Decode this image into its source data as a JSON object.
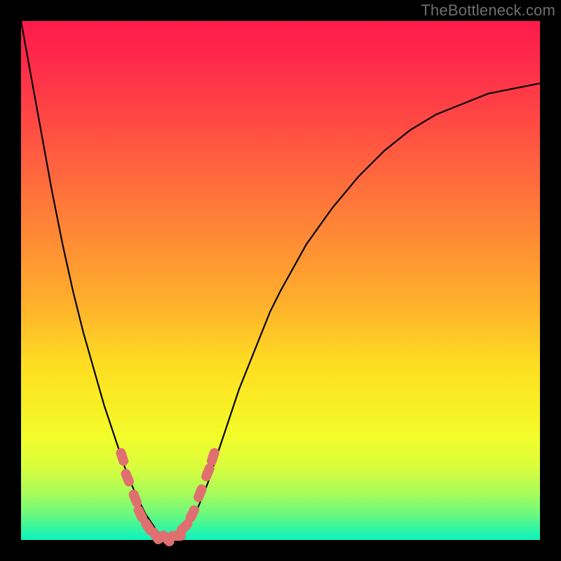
{
  "watermark": "TheBottleneck.com",
  "gradient_colors": {
    "top": "#fe1a4b",
    "mid_upper": "#ff6f3c",
    "mid": "#fedd22",
    "mid_lower": "#d9fd3c",
    "bottom": "#0cf3c0"
  },
  "chart_data": {
    "type": "line",
    "title": "",
    "xlabel": "",
    "ylabel": "",
    "xlim": [
      0,
      100
    ],
    "ylim": [
      0,
      100
    ],
    "x": [
      0,
      2,
      4,
      6,
      8,
      10,
      12,
      14,
      16,
      18,
      20,
      22,
      24,
      26,
      28,
      30,
      32,
      34,
      36,
      38,
      40,
      42,
      44,
      46,
      48,
      50,
      55,
      60,
      65,
      70,
      75,
      80,
      85,
      90,
      95,
      100
    ],
    "values": [
      100,
      89,
      78,
      67,
      57,
      48,
      40,
      33,
      26,
      20,
      14,
      9,
      5,
      2,
      0,
      0,
      2,
      6,
      11,
      17,
      23,
      29,
      34,
      39,
      44,
      48,
      57,
      64,
      70,
      75,
      79,
      82,
      84,
      86,
      87,
      88
    ],
    "curve_min_x": 28,
    "note": "V-shaped bottleneck curve; y=0 is optimal (green), y=100 is worst (red).",
    "markers": {
      "color": "#e07070",
      "points": [
        {
          "x": 19.5,
          "y": 16
        },
        {
          "x": 20.5,
          "y": 12
        },
        {
          "x": 22.0,
          "y": 8
        },
        {
          "x": 23.0,
          "y": 5
        },
        {
          "x": 24.5,
          "y": 2.5
        },
        {
          "x": 26.0,
          "y": 0.8
        },
        {
          "x": 28.0,
          "y": 0.3
        },
        {
          "x": 30.0,
          "y": 0.8
        },
        {
          "x": 31.5,
          "y": 2.5
        },
        {
          "x": 33.0,
          "y": 5
        },
        {
          "x": 34.5,
          "y": 9
        },
        {
          "x": 36.0,
          "y": 13
        },
        {
          "x": 37.0,
          "y": 16
        }
      ]
    }
  }
}
